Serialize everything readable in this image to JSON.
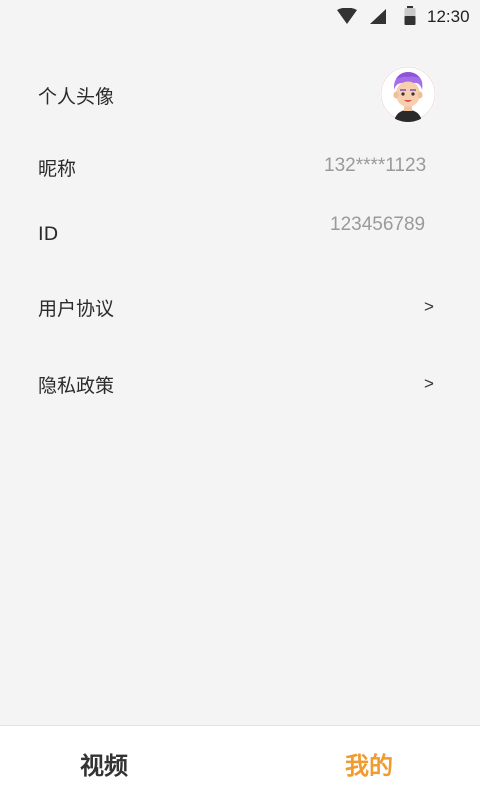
{
  "status_bar": {
    "time": "12:30",
    "icons": [
      "wifi-icon",
      "signal-icon",
      "battery-icon"
    ]
  },
  "profile": {
    "avatar_label": "个人头像",
    "nickname_label": "昵称",
    "nickname_value": "132****1123",
    "id_label": "ID",
    "id_value": "123456789",
    "user_agreement_label": "用户协议",
    "privacy_policy_label": "隐私政策",
    "chevron": ">"
  },
  "tabbar": {
    "tabs": [
      {
        "label": "视频",
        "active": false
      },
      {
        "label": "我的",
        "active": true
      }
    ],
    "active_color": "#f19a2e",
    "inactive_color": "#333333"
  }
}
